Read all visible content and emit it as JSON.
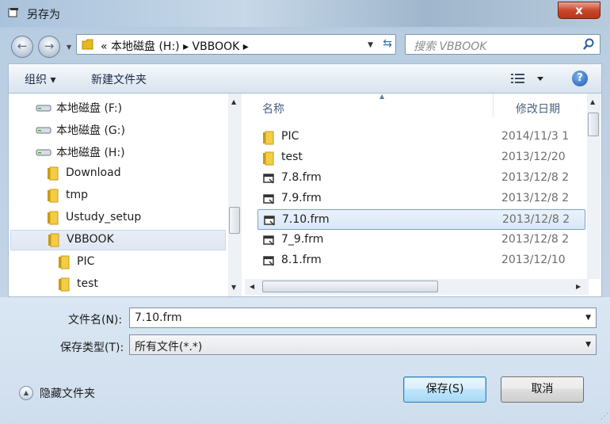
{
  "window": {
    "title": "另存为",
    "close_label": "x"
  },
  "nav": {
    "back_glyph": "←",
    "forward_glyph": "→",
    "address_crumbs": "«  本地磁盘 (H:)  ▸  VBBOOK  ▸",
    "search_placeholder": "搜索 VBBOOK"
  },
  "toolbar": {
    "organize_label": "组织 ▾",
    "new_folder_label": "新建文件夹",
    "help_glyph": "?"
  },
  "tree": {
    "items": [
      {
        "label": "本地磁盘 (F:)",
        "icon": "drive-icon"
      },
      {
        "label": "本地磁盘 (G:)",
        "icon": "drive-icon"
      },
      {
        "label": "本地磁盘 (H:)",
        "icon": "drive-icon"
      },
      {
        "label": "Download",
        "icon": "folder-icon"
      },
      {
        "label": "tmp",
        "icon": "folder-icon"
      },
      {
        "label": "Ustudy_setup",
        "icon": "folder-icon"
      },
      {
        "label": "VBBOOK",
        "icon": "folder-icon",
        "selected": true
      },
      {
        "label": "PIC",
        "icon": "folder-icon"
      },
      {
        "label": "test",
        "icon": "folder-icon"
      }
    ]
  },
  "files": {
    "headers": {
      "name": "名称",
      "date": "修改日期"
    },
    "rows": [
      {
        "name": "PIC",
        "date": "2014/11/3 1",
        "icon": "folder-icon"
      },
      {
        "name": "test",
        "date": "2013/12/20",
        "icon": "folder-icon"
      },
      {
        "name": "7.8.frm",
        "date": "2013/12/8 2",
        "icon": "form-file-icon"
      },
      {
        "name": "7.9.frm",
        "date": "2013/12/8 2",
        "icon": "form-file-icon"
      },
      {
        "name": "7.10.frm",
        "date": "2013/12/8 2",
        "icon": "form-file-icon",
        "selected": true
      },
      {
        "name": "7_9.frm",
        "date": "2013/12/8 2",
        "icon": "form-file-icon"
      },
      {
        "name": "8.1.frm",
        "date": "2013/12/10",
        "icon": "form-file-icon"
      }
    ]
  },
  "form": {
    "filename_label": "文件名(N):",
    "filename_value": "7.10.frm",
    "filetype_label": "保存类型(T):",
    "filetype_value": "所有文件(*.*)"
  },
  "footer": {
    "hide_folders_label": "隐藏文件夹",
    "save_label": "保存(S)",
    "cancel_label": "取消"
  }
}
